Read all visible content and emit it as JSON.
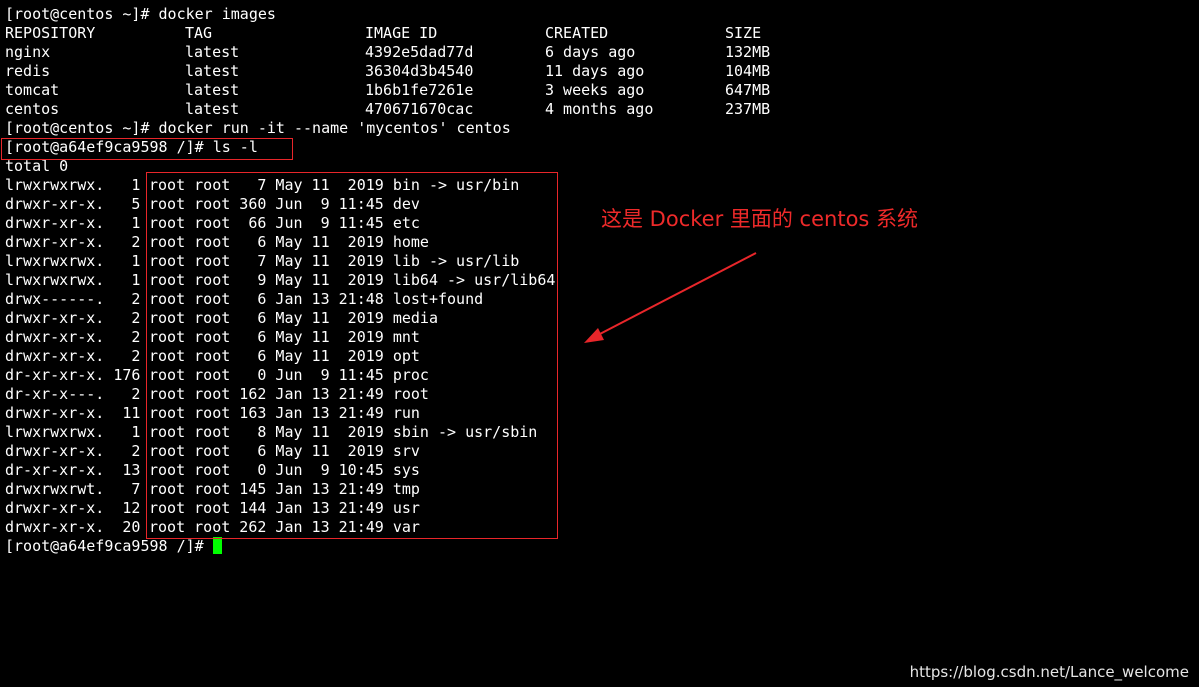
{
  "terminal": {
    "cmd_images": "[root@centos ~]# docker images",
    "images_header": {
      "repository": "REPOSITORY",
      "tag": "TAG",
      "image_id": "IMAGE ID",
      "created": "CREATED",
      "size": "SIZE"
    },
    "images": [
      {
        "repository": "nginx",
        "tag": "latest",
        "image_id": "4392e5dad77d",
        "created": "6 days ago",
        "size": "132MB"
      },
      {
        "repository": "redis",
        "tag": "latest",
        "image_id": "36304d3b4540",
        "created": "11 days ago",
        "size": "104MB"
      },
      {
        "repository": "tomcat",
        "tag": "latest",
        "image_id": "1b6b1fe7261e",
        "created": "3 weeks ago",
        "size": "647MB"
      },
      {
        "repository": "centos",
        "tag": "latest",
        "image_id": "470671670cac",
        "created": "4 months ago",
        "size": "237MB"
      }
    ],
    "cmd_run": "[root@centos ~]# docker run -it --name 'mycentos' centos",
    "cmd_ls": "[root@a64ef9ca9598 /]# ls -l",
    "total": "total 0",
    "listing": [
      {
        "perms": "lrwxrwxrwx.   1",
        "entry": "root root   7 May 11  2019 bin -> usr/bin"
      },
      {
        "perms": "drwxr-xr-x.   5",
        "entry": "root root 360 Jun  9 11:45 dev"
      },
      {
        "perms": "drwxr-xr-x.   1",
        "entry": "root root  66 Jun  9 11:45 etc"
      },
      {
        "perms": "drwxr-xr-x.   2",
        "entry": "root root   6 May 11  2019 home"
      },
      {
        "perms": "lrwxrwxrwx.   1",
        "entry": "root root   7 May 11  2019 lib -> usr/lib"
      },
      {
        "perms": "lrwxrwxrwx.   1",
        "entry": "root root   9 May 11  2019 lib64 -> usr/lib64"
      },
      {
        "perms": "drwx------.   2",
        "entry": "root root   6 Jan 13 21:48 lost+found"
      },
      {
        "perms": "drwxr-xr-x.   2",
        "entry": "root root   6 May 11  2019 media"
      },
      {
        "perms": "drwxr-xr-x.   2",
        "entry": "root root   6 May 11  2019 mnt"
      },
      {
        "perms": "drwxr-xr-x.   2",
        "entry": "root root   6 May 11  2019 opt"
      },
      {
        "perms": "dr-xr-xr-x. 176",
        "entry": "root root   0 Jun  9 11:45 proc"
      },
      {
        "perms": "dr-xr-x---.   2",
        "entry": "root root 162 Jan 13 21:49 root"
      },
      {
        "perms": "drwxr-xr-x.  11",
        "entry": "root root 163 Jan 13 21:49 run"
      },
      {
        "perms": "lrwxrwxrwx.   1",
        "entry": "root root   8 May 11  2019 sbin -> usr/sbin"
      },
      {
        "perms": "drwxr-xr-x.   2",
        "entry": "root root   6 May 11  2019 srv"
      },
      {
        "perms": "dr-xr-xr-x.  13",
        "entry": "root root   0 Jun  9 10:45 sys"
      },
      {
        "perms": "drwxrwxrwt.   7",
        "entry": "root root 145 Jan 13 21:49 tmp"
      },
      {
        "perms": "drwxr-xr-x.  12",
        "entry": "root root 144 Jan 13 21:49 usr"
      },
      {
        "perms": "drwxr-xr-x.  20",
        "entry": "root root 262 Jan 13 21:49 var"
      }
    ],
    "final_prompt": "[root@a64ef9ca9598 /]# "
  },
  "annotation": {
    "text": "这是 Docker 里面的 centos 系统",
    "color": "#ee2a2a"
  },
  "watermark": "https://blog.csdn.net/Lance_welcome",
  "colors": {
    "background": "#000000",
    "text": "#ffffff",
    "cursor": "#00ff00",
    "highlight": "#e8262a"
  }
}
